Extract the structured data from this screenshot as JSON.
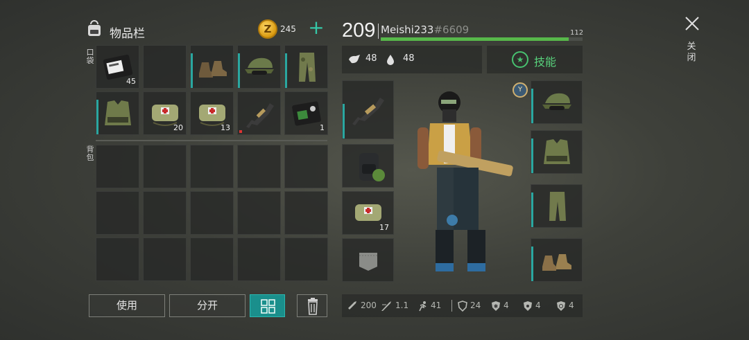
{
  "inventory": {
    "title": "物品栏",
    "coin_symbol": "Z",
    "coins": "245",
    "add_symbol": "+",
    "pocket_label": "口袋",
    "backpack_label": "背包",
    "pocket_row1_counts": [
      "45",
      "",
      "",
      "",
      ""
    ],
    "pocket_row2_counts": [
      "",
      "20",
      "13",
      "",
      "1"
    ]
  },
  "actions": {
    "use_label": "使用",
    "split_label": "分开"
  },
  "player": {
    "level": "209",
    "name": "Meishi233",
    "tag": "#6609",
    "xp_value": "112",
    "xp_fraction": 0.93
  },
  "stats": {
    "food": "48",
    "water": "48",
    "skills_star": "★",
    "skills_label": "技能"
  },
  "equipment": {
    "medkit_count": "17",
    "rank_symbol": "Y"
  },
  "bottom_stats": {
    "attack": "200",
    "attack_speed": "1.1",
    "speed": "41",
    "armor": "24",
    "cold_resist": "4",
    "radiation_resist": "4",
    "infection_resist": "4"
  },
  "window": {
    "close_label": "关闭"
  },
  "colors": {
    "accent_teal": "#1a8f8c",
    "xp_green": "#57b84a",
    "skills_green": "#58d27c"
  }
}
